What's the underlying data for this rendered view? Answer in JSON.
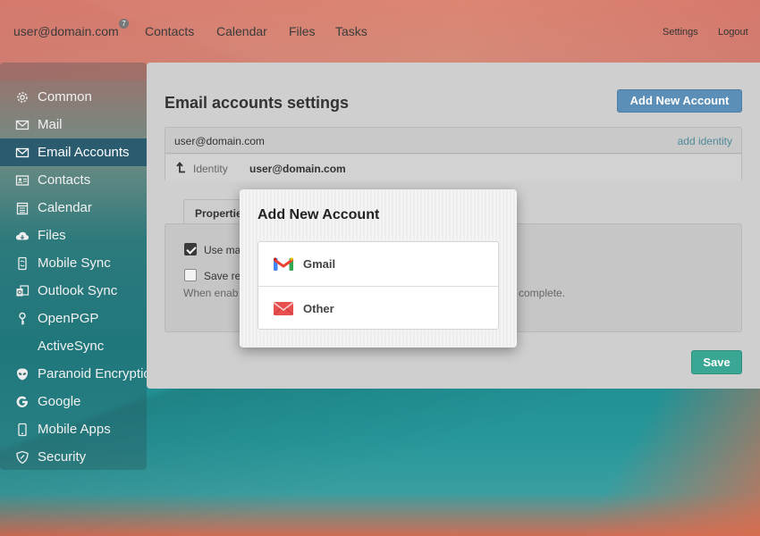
{
  "topnav": {
    "user": "user@domain.com",
    "badge": "7",
    "links": [
      "Contacts",
      "Calendar",
      "Files",
      "Tasks"
    ],
    "settings": "Settings",
    "logout": "Logout"
  },
  "sidebar": {
    "items": [
      {
        "label": "Common",
        "icon": "gear-icon"
      },
      {
        "label": "Mail",
        "icon": "envelope-icon"
      },
      {
        "label": "Email Accounts",
        "icon": "envelope-icon",
        "active": true
      },
      {
        "label": "Contacts",
        "icon": "contact-card-icon"
      },
      {
        "label": "Calendar",
        "icon": "calendar-icon"
      },
      {
        "label": "Files",
        "icon": "cloud-download-icon"
      },
      {
        "label": "Mobile Sync",
        "icon": "mobile-sync-icon"
      },
      {
        "label": "Outlook Sync",
        "icon": "outlook-sync-icon"
      },
      {
        "label": "OpenPGP",
        "icon": "key-icon"
      },
      {
        "label": "ActiveSync",
        "icon": ""
      },
      {
        "label": "Paranoid Encryption",
        "icon": "alien-icon"
      },
      {
        "label": "Google",
        "icon": "google-icon"
      },
      {
        "label": "Mobile Apps",
        "icon": "phone-icon"
      },
      {
        "label": "Security",
        "icon": "shield-icon"
      }
    ]
  },
  "main": {
    "title": "Email accounts settings",
    "add_button": "Add New Account",
    "account_email": "user@domain.com",
    "add_identity": "add identity",
    "identity_label": "Identity",
    "identity_value": "user@domain.com",
    "tab_properties": "Properties",
    "option1": "Use mail",
    "option1_checked": true,
    "option2": "Save re",
    "option2_checked": false,
    "hint_left": "When enab",
    "hint_right": "e complete.",
    "save_button": "Save"
  },
  "modal": {
    "title": "Add New Account",
    "choices": [
      {
        "label": "Gmail",
        "icon": "gmail-icon"
      },
      {
        "label": "Other",
        "icon": "envelope-red-icon"
      }
    ]
  },
  "colors": {
    "accent_blue": "#5b8fb8",
    "save_green": "#3aa794",
    "active_sidebar": "#2b5b6f",
    "link_teal": "#4d8a96"
  }
}
